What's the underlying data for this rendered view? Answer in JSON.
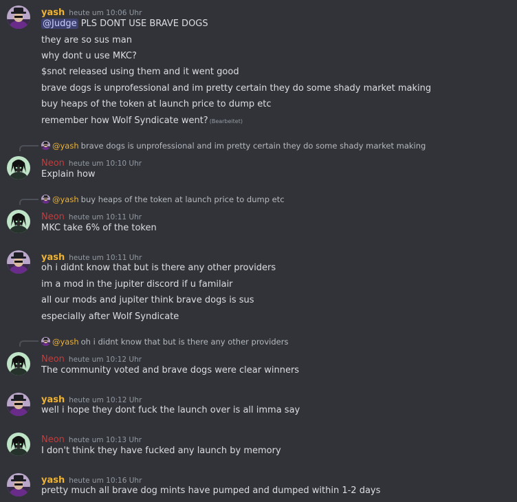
{
  "messages": {
    "m1": {
      "username": "yash",
      "timestamp": "heute um 10:06 Uhr",
      "mention": "@Judge",
      "line1_rest": " PLS DONT USE BRAVE DOGS",
      "lines": [
        "they are so sus man",
        "why dont u use MKC?",
        "$snot released using them and it went good",
        "brave dogs is unprofessional and im pretty certain they do some shady market making",
        "buy heaps of the token at launch price to dump etc",
        "remember how Wolf Syndicate went?"
      ],
      "edited": "(Bearbeitet)"
    },
    "m2": {
      "reply_user": "@yash",
      "reply_text": "brave dogs is unprofessional and im pretty certain they do some shady market making",
      "username": "Neon",
      "timestamp": "heute um 10:10 Uhr",
      "lines": [
        "Explain how"
      ]
    },
    "m3": {
      "reply_user": "@yash",
      "reply_text": "buy heaps of the token at launch price to dump etc",
      "username": "Neon",
      "timestamp": "heute um 10:11 Uhr",
      "lines": [
        "MKC take 6% of the token"
      ]
    },
    "m4": {
      "username": "yash",
      "timestamp": "heute um 10:11 Uhr",
      "lines": [
        "oh i didnt know that but is there any other providers",
        "im a mod in the jupiter discord if u familair",
        "all our mods and jupiter think brave dogs is sus",
        "especially after Wolf Syndicate"
      ]
    },
    "m5": {
      "reply_user": "@yash",
      "reply_text": "oh i didnt know that but is there any other providers",
      "username": "Neon",
      "timestamp": "heute um 10:12 Uhr",
      "lines": [
        "The community voted and brave dogs were clear winners"
      ]
    },
    "m6": {
      "username": "yash",
      "timestamp": "heute um 10:12 Uhr",
      "lines": [
        "well i hope they dont fuck the launch over is all imma say"
      ]
    },
    "m7": {
      "username": "Neon",
      "timestamp": "heute um 10:13 Uhr",
      "lines": [
        "I don't think they have fucked any launch by memory"
      ]
    },
    "m8": {
      "username": "yash",
      "timestamp": "heute um 10:16 Uhr",
      "lines": [
        "pretty much all brave dog mints have pumped and dumped within 1-2 days"
      ]
    }
  },
  "colors": {
    "background": "#313338",
    "yash": "#f0b232",
    "neon": "#c93a3a",
    "text": "#dbdee1",
    "muted": "#949ba4"
  },
  "icons": {
    "yash_avatar": "yash-avatar-icon",
    "neon_avatar": "neon-avatar-icon"
  }
}
